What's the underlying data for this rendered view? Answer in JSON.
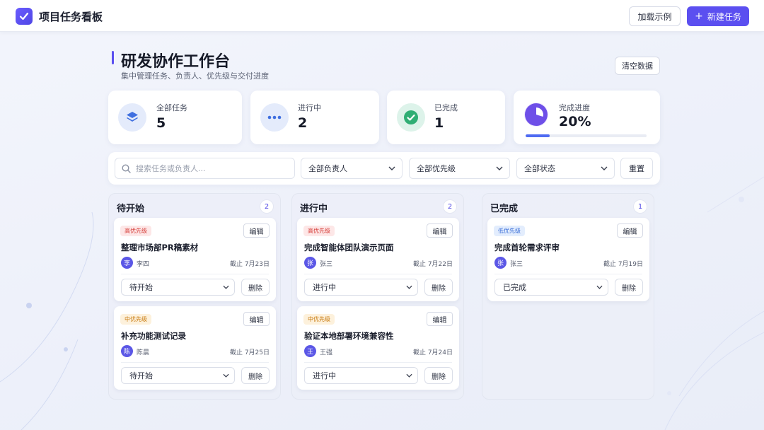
{
  "header": {
    "app_title": "项目任务看板",
    "load_example_label": "加载示例",
    "new_task_label": "新建任务"
  },
  "page": {
    "title": "研发协作工作台",
    "subtitle": "集中管理任务、负责人、优先级与交付进度",
    "clear_label": "清空数据"
  },
  "stats": {
    "total": {
      "label": "全部任务",
      "value": "5"
    },
    "in_progress": {
      "label": "进行中",
      "value": "2"
    },
    "done": {
      "label": "已完成",
      "value": "1"
    },
    "progress": {
      "label": "完成进度",
      "value": "20%",
      "fraction": 0.2
    }
  },
  "filters": {
    "search_placeholder": "搜索任务或负责人...",
    "assignee": "全部负责人",
    "priority": "全部优先级",
    "status": "全部状态",
    "reset_label": "重置"
  },
  "card_actions": {
    "edit": "编辑",
    "delete": "删除"
  },
  "columns": [
    {
      "title": "待开始",
      "count": "2",
      "tasks": [
        {
          "priority": "高优先级",
          "title": "整理市场部PR稿素材",
          "avatar": "李",
          "assignee": "李四",
          "due": "截止 7月23日",
          "status": "待开始"
        },
        {
          "priority": "中优先级",
          "title": "补充功能测试记录",
          "avatar": "陈",
          "assignee": "陈晨",
          "due": "截止 7月25日",
          "status": "待开始"
        }
      ]
    },
    {
      "title": "进行中",
      "count": "2",
      "tasks": [
        {
          "priority": "高优先级",
          "title": "完成智能体团队演示页面",
          "avatar": "张",
          "assignee": "张三",
          "due": "截止 7月22日",
          "status": "进行中"
        },
        {
          "priority": "中优先级",
          "title": "验证本地部署环境兼容性",
          "avatar": "王",
          "assignee": "王强",
          "due": "截止 7月24日",
          "status": "进行中"
        }
      ]
    },
    {
      "title": "已完成",
      "count": "1",
      "tasks": [
        {
          "priority": "低优先级",
          "title": "完成首轮需求评审",
          "avatar": "张",
          "assignee": "张三",
          "due": "截止 7月19日",
          "status": "已完成"
        }
      ]
    }
  ],
  "colors": {
    "accent": "#5b4ff0",
    "high_priority": "#d6403b",
    "mid_priority": "#c97c12",
    "low_priority": "#3b6fd8",
    "progress_fill": "#4f6bf2"
  }
}
